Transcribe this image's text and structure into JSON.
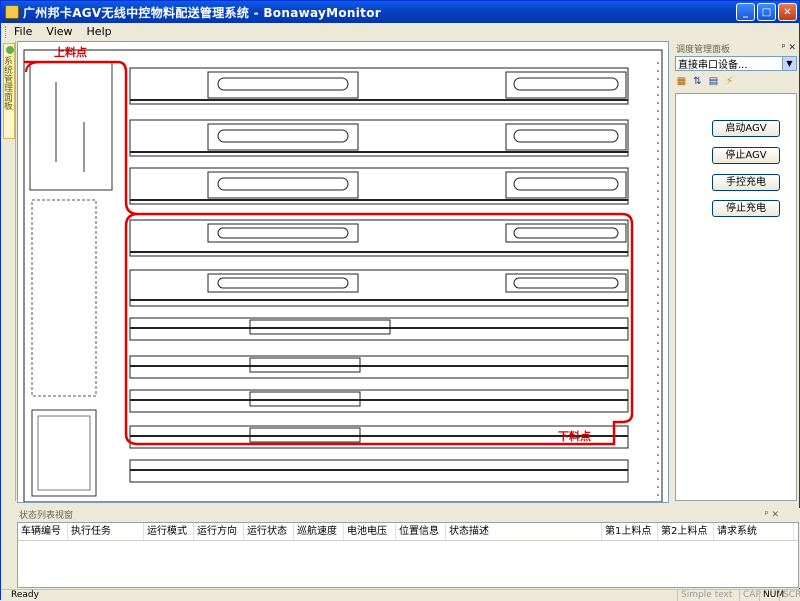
{
  "window": {
    "title": "广州邦卡AGV无线中控物料配送管理系统 - BonawayMonitor",
    "min_glyph": "_",
    "max_glyph": "□",
    "close_glyph": "✕"
  },
  "menu": [
    {
      "label": "File"
    },
    {
      "label": "View"
    },
    {
      "label": "Help"
    }
  ],
  "left_tab": {
    "label": "系统管理面板"
  },
  "map": {
    "load_point_label": "上料点",
    "unload_point_label": "下料点"
  },
  "right_panel": {
    "title": "调度管理面板",
    "pin_glyph": "ᵖ ✕",
    "port_select": "直接串口设备...",
    "tools": [
      {
        "name": "grid-icon",
        "glyph": "▦"
      },
      {
        "name": "sort-icon",
        "glyph": "⇅"
      },
      {
        "name": "list-icon",
        "glyph": "▤"
      },
      {
        "name": "lightning-icon",
        "glyph": "⚡"
      }
    ],
    "buttons": [
      "启动AGV",
      "停止AGV",
      "手控充电",
      "停止充电"
    ]
  },
  "bottom_panel": {
    "title": "状态列表视窗",
    "pin_glyph": "ᵖ ✕",
    "columns": [
      {
        "label": "车辆编号",
        "w": 50
      },
      {
        "label": "执行任务",
        "w": 76
      },
      {
        "label": "运行模式",
        "w": 50
      },
      {
        "label": "运行方向",
        "w": 50
      },
      {
        "label": "运行状态",
        "w": 50
      },
      {
        "label": "巡航速度",
        "w": 50
      },
      {
        "label": "电池电压",
        "w": 52
      },
      {
        "label": "位置信息",
        "w": 50
      },
      {
        "label": "状态描述",
        "w": 156
      },
      {
        "label": "第1上料点",
        "w": 56
      },
      {
        "label": "第2上料点",
        "w": 56
      },
      {
        "label": "请求系统",
        "w": 80
      }
    ]
  },
  "status": {
    "ready": "Ready",
    "indicators": [
      "Simple text",
      "CAP",
      "NUM",
      "SCRL"
    ]
  },
  "colors": {
    "title_blue": "#0842c6",
    "route_red": "#e00000"
  }
}
